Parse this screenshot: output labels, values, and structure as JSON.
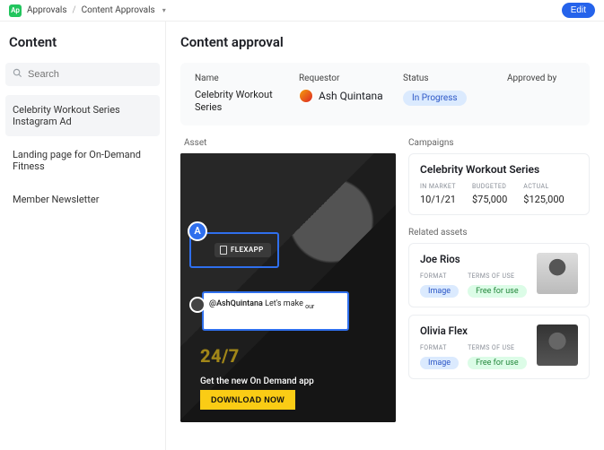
{
  "topbar": {
    "app_badge": "Ap",
    "crumb1": "Approvals",
    "crumb2": "Content Approvals",
    "edit_label": "Edit"
  },
  "sidebar": {
    "title": "Content",
    "search_placeholder": "Search",
    "items": [
      {
        "label": "Celebrity Workout Series Instagram Ad"
      },
      {
        "label": "Landing page for On-Demand Fitness"
      },
      {
        "label": "Member Newsletter"
      }
    ]
  },
  "main": {
    "title": "Content approval",
    "info": {
      "labels": {
        "name": "Name",
        "requestor": "Requestor",
        "status": "Status",
        "approved_by": "Approved by"
      },
      "name": "Celebrity Workout Series",
      "requestor": "Ash Quintana",
      "status": "In Progress"
    },
    "asset": {
      "label": "Asset",
      "selection_initial": "A",
      "selection_chip": "FLEXAPP",
      "comment_mention": "@AshQuintana",
      "comment_text": " Let's make ",
      "comment_trail": "our",
      "overlay_247": "24/7",
      "overlay_sub": "Get the new On Demand app",
      "overlay_btn": "DOWNLOAD NOW"
    },
    "campaigns": {
      "label": "Campaigns",
      "title": "Celebrity Workout Series",
      "meta_labels": {
        "in_market": "IN MARKET",
        "budgeted": "BUDGETED",
        "actual": "ACTUAL"
      },
      "in_market": "10/1/21",
      "budgeted": "$75,000",
      "actual": "$125,000"
    },
    "related": {
      "label": "Related assets",
      "tag_labels": {
        "format": "FORMAT",
        "terms": "TERMS OF USE"
      },
      "items": [
        {
          "name": "Joe Rios",
          "format": "Image",
          "terms": "Free for use"
        },
        {
          "name": "Olivia Flex",
          "format": "Image",
          "terms": "Free for use"
        }
      ]
    }
  }
}
